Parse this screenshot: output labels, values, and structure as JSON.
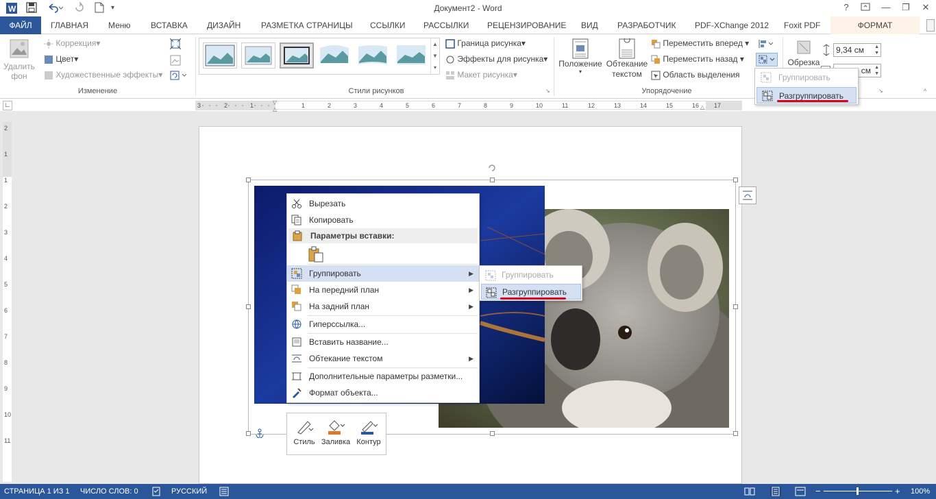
{
  "window": {
    "title": "Документ2 - Word",
    "help": "?",
    "minimize": "—",
    "restore": "❐",
    "close": "✕"
  },
  "tabs": [
    "ФАЙЛ",
    "ГЛАВНАЯ",
    "Меню",
    "ВСТАВКА",
    "ДИЗАЙН",
    "РАЗМЕТКА СТРАНИЦЫ",
    "ССЫЛКИ",
    "РАССЫЛКИ",
    "РЕЦЕНЗИРОВАНИЕ",
    "ВИД",
    "РАЗРАБОТЧИК",
    "PDF-XChange 2012",
    "Foxit PDF",
    "ФОРМАТ"
  ],
  "ribbon": {
    "remove_bg": "Удалить фон",
    "correction": "Коррекция",
    "color": "Цвет",
    "art_effects": "Художественные эффекты",
    "group_change": "Изменение",
    "group_styles": "Стили рисунков",
    "border": "Граница рисунка",
    "effects": "Эффекты для рисунка",
    "layout": "Макет рисунка",
    "position": "Положение",
    "wrap": "Обтекание текстом",
    "forward": "Переместить вперед",
    "backward": "Переместить назад",
    "selection": "Область выделения",
    "group_arrange": "Упорядочение",
    "crop": "Обрезка",
    "width": "9,34 см",
    "height_partial": "см"
  },
  "ribbon_dropdown": {
    "group": "Группировать",
    "ungroup": "Разгруппировать"
  },
  "ruler": [
    "3",
    "2",
    "1",
    "1",
    "2",
    "3",
    "4",
    "5",
    "6",
    "7",
    "8",
    "9",
    "10",
    "11",
    "12",
    "13",
    "14",
    "15",
    "16",
    "17"
  ],
  "vruler": [
    "2",
    "1",
    "1",
    "2",
    "3",
    "4",
    "5",
    "6",
    "7",
    "8",
    "9",
    "10",
    "11"
  ],
  "context_menu": {
    "cut": "Вырезать",
    "copy": "Копировать",
    "paste_options": "Параметры вставки:",
    "group": "Группировать",
    "bring_front": "На передний план",
    "send_back": "На задний план",
    "hyperlink": "Гиперссылка...",
    "insert_caption": "Вставить название...",
    "wrap_text": "Обтекание текстом",
    "more_layout": "Дополнительные параметры разметки...",
    "format_object": "Формат объекта..."
  },
  "submenu": {
    "group": "Группировать",
    "ungroup": "Разгруппировать"
  },
  "mini_toolbar": {
    "style": "Стиль",
    "fill": "Заливка",
    "outline": "Контур"
  },
  "status": {
    "page": "СТРАНИЦА 1 ИЗ 1",
    "words": "ЧИСЛО СЛОВ: 0",
    "language": "РУССКИЙ",
    "zoom": "100%",
    "zoom_minus": "−",
    "zoom_plus": "+"
  },
  "colors": {
    "accent": "#2b579a",
    "highlight": "#d5e1f2",
    "underline_red": "#e0001b"
  }
}
